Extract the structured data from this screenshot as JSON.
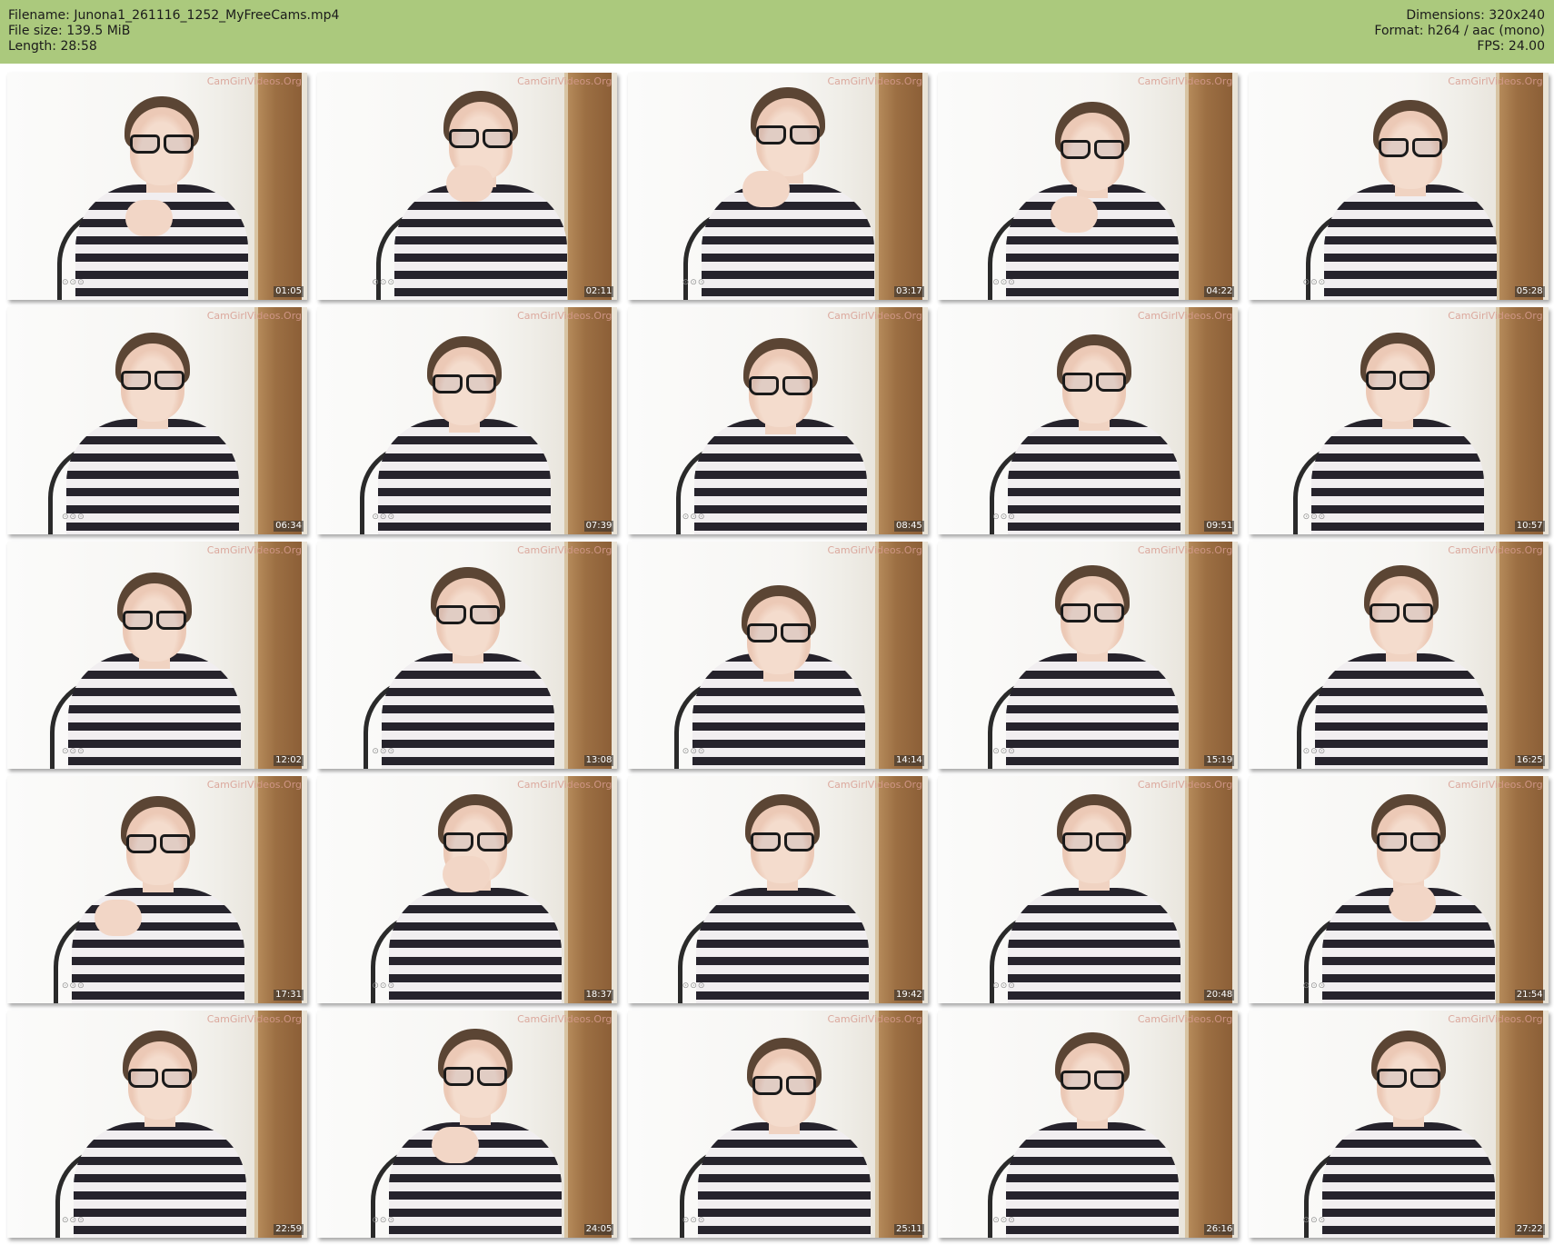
{
  "header": {
    "filename_label": "Filename:",
    "filename": "Junona1_261116_1252_MyFreeCams.mp4",
    "filesize_label": "File size:",
    "filesize": "139.5 MiB",
    "length_label": "Length:",
    "length": "28:58",
    "dimensions_label": "Dimensions:",
    "dimensions": "320x240",
    "format_label": "Format:",
    "format": "h264 / aac (mono)",
    "fps_label": "FPS:",
    "fps": "24.00"
  },
  "watermark": "CamGirlVideos.Org",
  "colors": {
    "header_bg": "#abc97d",
    "page_bg": "#ffffff",
    "stripe_dark": "#26232c",
    "stripe_light": "#f1eef0"
  },
  "thumbnails": [
    {
      "timestamp": "01:05"
    },
    {
      "timestamp": "02:11"
    },
    {
      "timestamp": "03:17"
    },
    {
      "timestamp": "04:22"
    },
    {
      "timestamp": "05:28"
    },
    {
      "timestamp": "06:34"
    },
    {
      "timestamp": "07:39"
    },
    {
      "timestamp": "08:45"
    },
    {
      "timestamp": "09:51"
    },
    {
      "timestamp": "10:57"
    },
    {
      "timestamp": "12:02"
    },
    {
      "timestamp": "13:08"
    },
    {
      "timestamp": "14:14"
    },
    {
      "timestamp": "15:19"
    },
    {
      "timestamp": "16:25"
    },
    {
      "timestamp": "17:31"
    },
    {
      "timestamp": "18:37"
    },
    {
      "timestamp": "19:42"
    },
    {
      "timestamp": "20:48"
    },
    {
      "timestamp": "21:54"
    },
    {
      "timestamp": "22:59"
    },
    {
      "timestamp": "24:05"
    },
    {
      "timestamp": "25:11"
    },
    {
      "timestamp": "26:16"
    },
    {
      "timestamp": "27:22"
    }
  ]
}
